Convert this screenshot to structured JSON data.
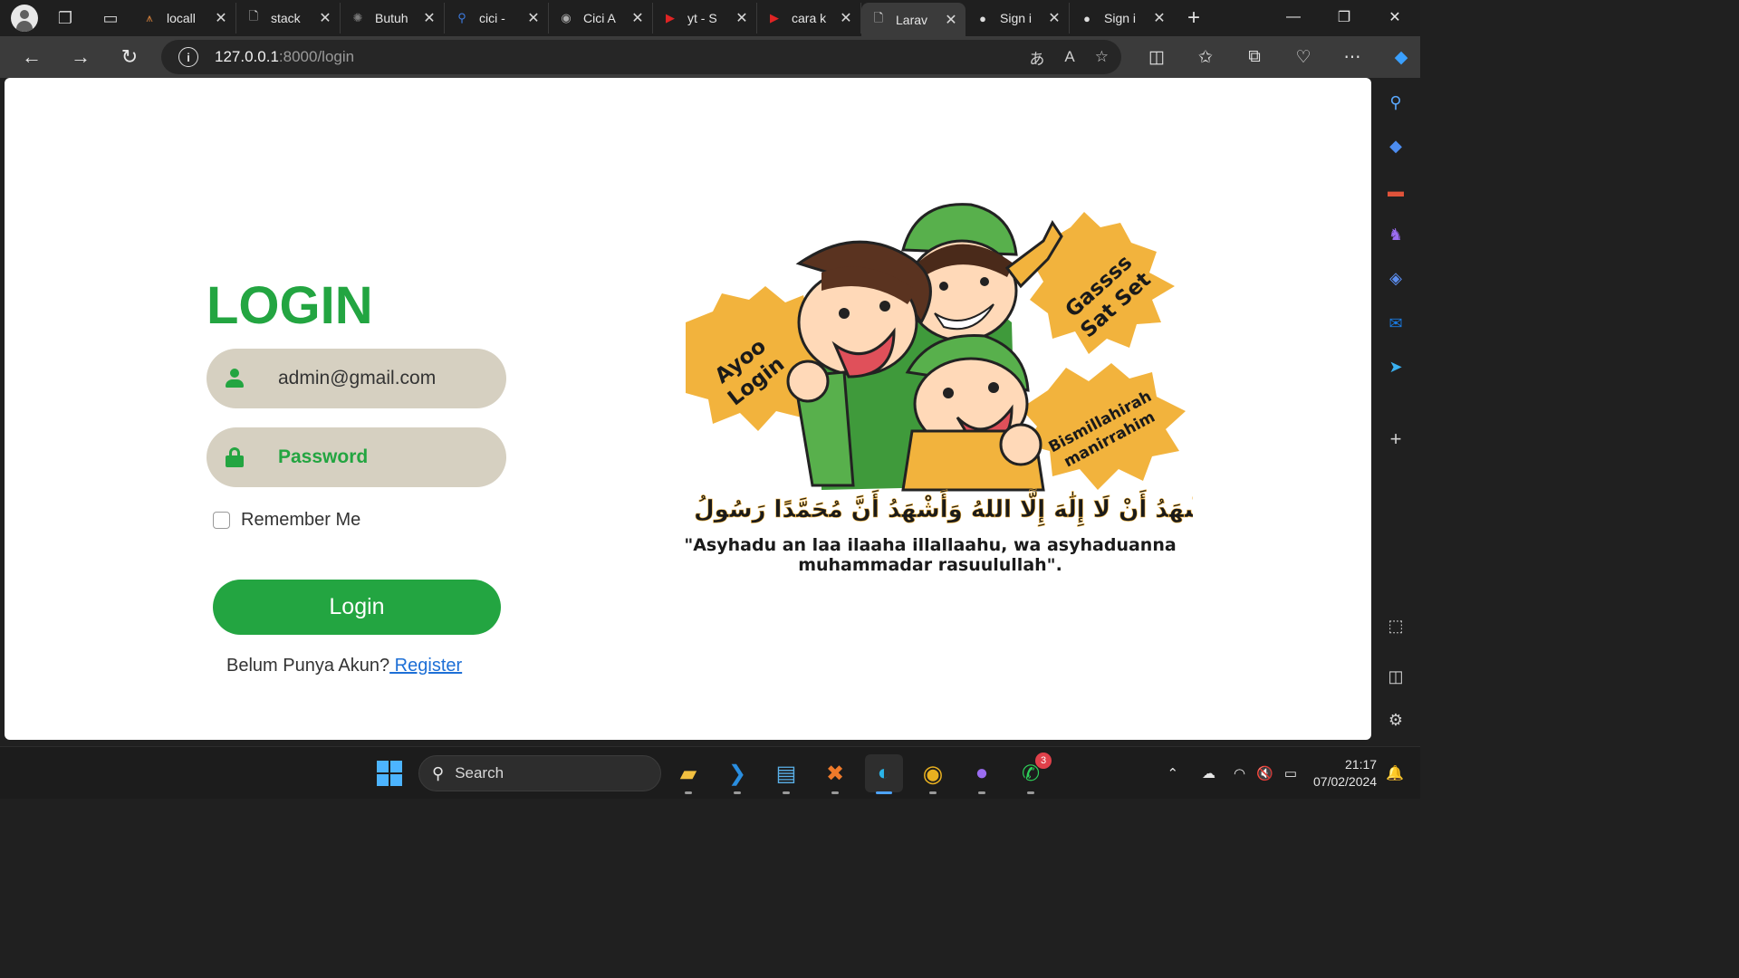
{
  "browser": {
    "tabs": [
      {
        "title": "locall",
        "icon": "laragon-icon"
      },
      {
        "title": "stack",
        "icon": "page-icon"
      },
      {
        "title": "Butuh",
        "icon": "openai-icon"
      },
      {
        "title": "cici -",
        "icon": "search-icon"
      },
      {
        "title": "Cici A",
        "icon": "avatar-icon"
      },
      {
        "title": "yt - S",
        "icon": "youtube-icon"
      },
      {
        "title": "cara k",
        "icon": "youtube-icon"
      },
      {
        "title": "Larav",
        "icon": "page-icon",
        "active": true
      },
      {
        "title": "Sign i",
        "icon": "github-icon"
      },
      {
        "title": "Sign i",
        "icon": "github-icon"
      }
    ],
    "address": {
      "host": "127.0.0.1",
      "path": ":8000/login"
    }
  },
  "login": {
    "title": "LOGIN",
    "email_value": "admin@gmail.com",
    "password_placeholder": "Password",
    "remember_label": "Remember Me",
    "button_label": "Login",
    "register_prompt": "Belum Punya Akun?",
    "register_link": " Register"
  },
  "illustration": {
    "bubble_left": [
      "Ayoo",
      "Login"
    ],
    "bubble_top": [
      "Gassss",
      "Sat Set"
    ],
    "bubble_right": [
      "Bismillahirah",
      "manirrahim"
    ],
    "arabic": "أَشْهَدُ أَنْ لَا إِلَٰهَ إِلَّا اللهُ وَأَشْهَدُ أَنَّ مُحَمَّدًا رَسُولُ اللهِ",
    "latin_line1": "\"Asyhadu an laa ilaaha illallaahu, wa asyhaduanna",
    "latin_line2": "muhammadar rasuulullah\"."
  },
  "taskbar": {
    "search_label": "Search",
    "whatsapp_badge": "3",
    "time": "21:17",
    "date": "07/02/2024"
  },
  "colors": {
    "accent": "#23a541",
    "field_bg": "#d6d0c1",
    "link": "#1d6fd6",
    "bubble": "#f2b33d"
  }
}
